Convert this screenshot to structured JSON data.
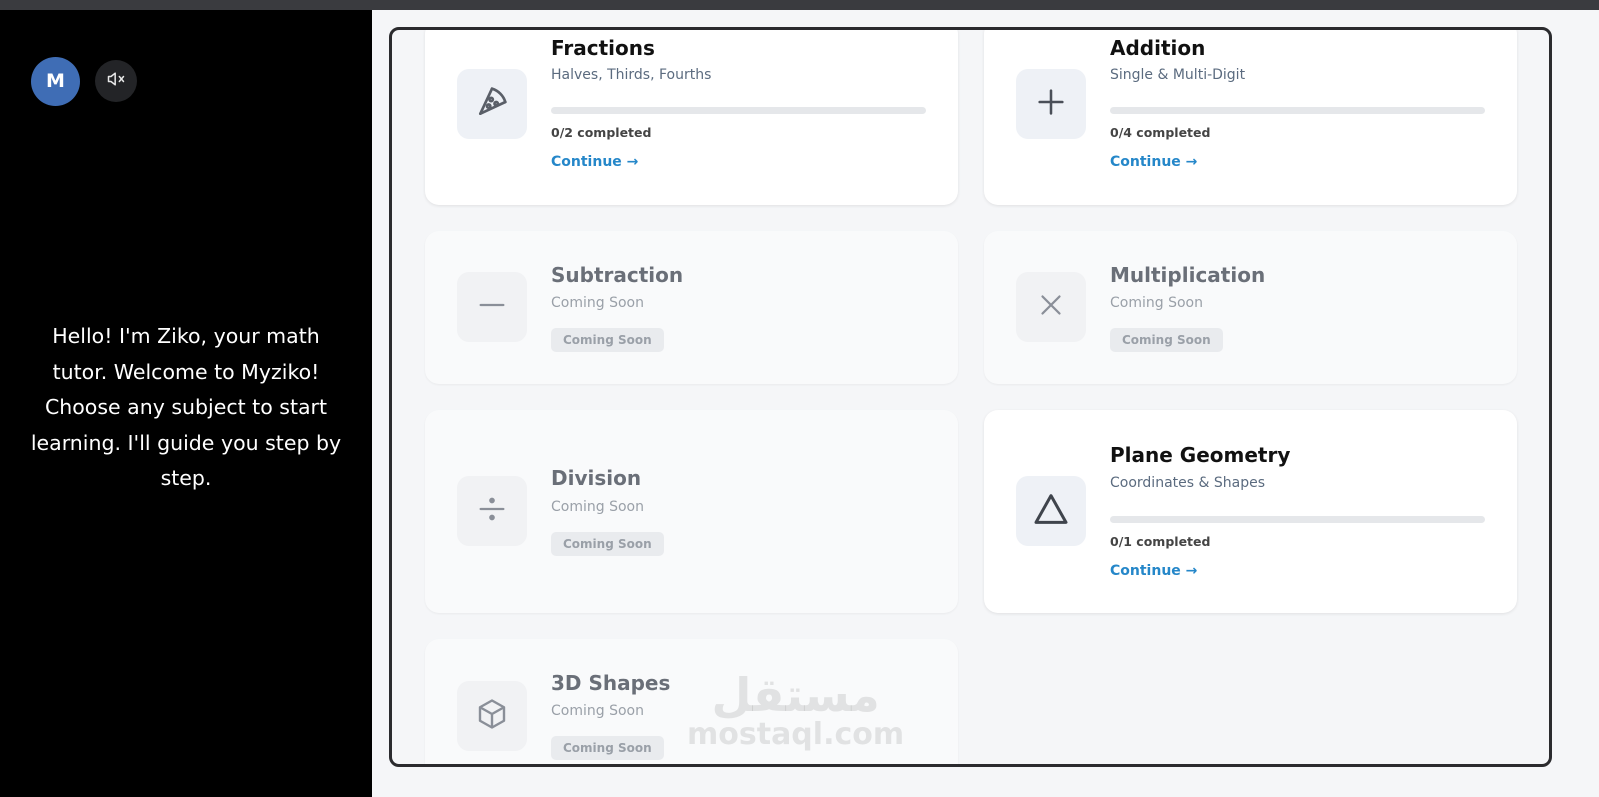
{
  "user": {
    "avatar_initial": "M"
  },
  "tutor": {
    "message": "Hello! I'm Ziko, your math tutor. Welcome to Myziko! Choose any subject to start learning. I'll guide you step by step."
  },
  "subjects": [
    {
      "title": "Fractions",
      "subtitle": "Halves, Thirds, Fourths",
      "icon": "pizza-slice-icon",
      "progress": 0,
      "completed_text": "0/2 completed",
      "action": "Continue →"
    },
    {
      "title": "Addition",
      "subtitle": "Single & Multi-Digit",
      "icon": "plus-icon",
      "progress": 0,
      "completed_text": "0/4 completed",
      "action": "Continue →"
    },
    {
      "title": "Subtraction",
      "subtitle": "Coming Soon",
      "icon": "minus-icon",
      "badge": "Coming Soon"
    },
    {
      "title": "Multiplication",
      "subtitle": "Coming Soon",
      "icon": "times-icon",
      "badge": "Coming Soon"
    },
    {
      "title": "Division",
      "subtitle": "Coming Soon",
      "icon": "divide-icon",
      "badge": "Coming Soon"
    },
    {
      "title": "Plane Geometry",
      "subtitle": "Coordinates & Shapes",
      "icon": "triangle-icon",
      "progress": 0,
      "completed_text": "0/1 completed",
      "action": "Continue →"
    },
    {
      "title": "3D Shapes",
      "subtitle": "Coming Soon",
      "icon": "cube-icon",
      "badge": "Coming Soon"
    }
  ],
  "watermark": {
    "arabic": "مستقل",
    "latin": "mostaql.com"
  },
  "colors": {
    "accent": "#2587c9",
    "sidebar_bg": "#000000",
    "avatar_bg": "#3f6db5"
  }
}
